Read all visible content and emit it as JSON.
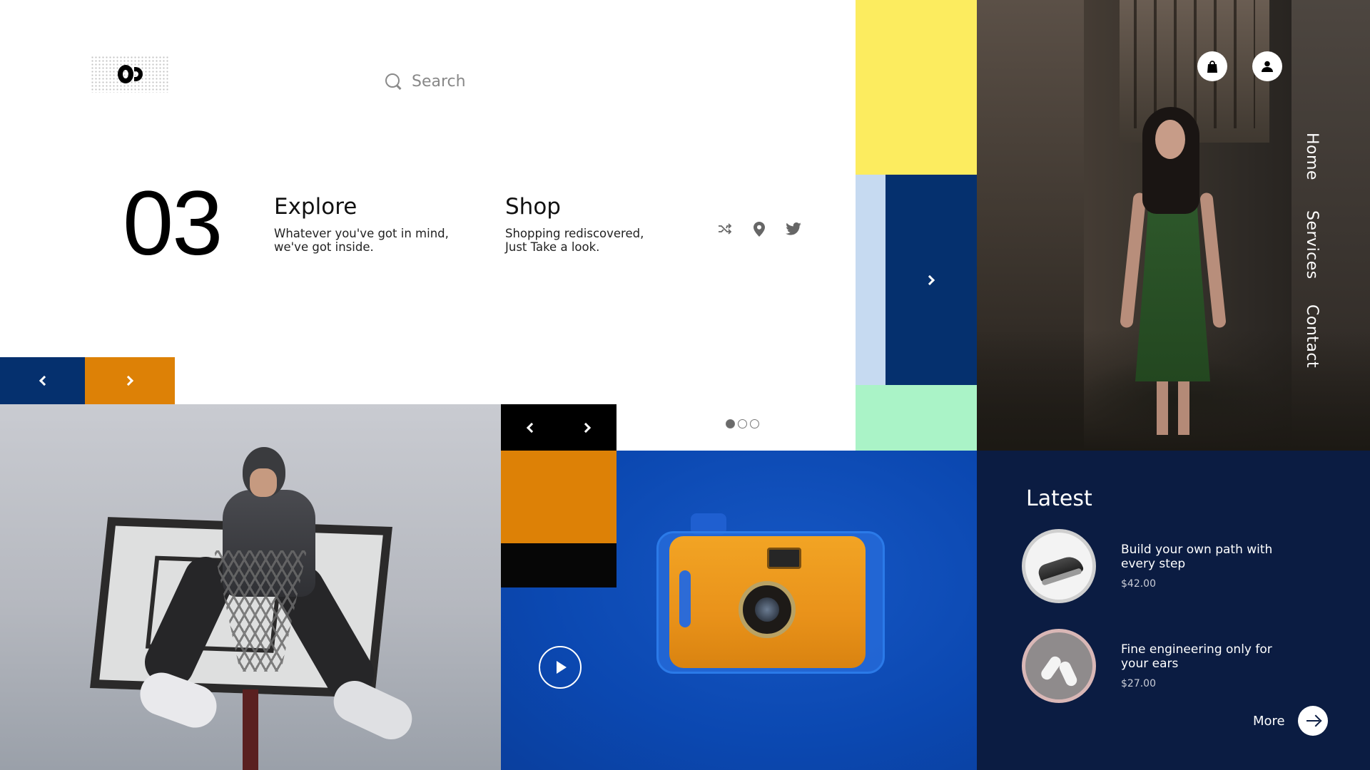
{
  "search": {
    "placeholder": "Search"
  },
  "hero": {
    "slide_number": "03",
    "blocks": [
      {
        "title": "Explore",
        "description": "Whatever you've got in mind,\nwe've got inside."
      },
      {
        "title": "Shop",
        "description": "Shopping rediscovered,\nJust Take a look."
      }
    ],
    "social_icons": [
      "shuffle-icon",
      "location-pin-icon",
      "twitter-icon"
    ],
    "carousel": {
      "total": 3,
      "active": 1
    }
  },
  "nav": {
    "items": [
      "Home",
      "Services",
      "Contact"
    ],
    "icons": [
      "shopping-bag-icon",
      "user-icon"
    ]
  },
  "colors": {
    "navy": "#05306e",
    "orange": "#dd8106",
    "yellow": "#fcec5f",
    "light_blue": "#c6daf1",
    "mint": "#aaf3c7",
    "royal_blue": "#0b48b1",
    "latest_bg": "#0b1c42"
  },
  "latest": {
    "title": "Latest",
    "items": [
      {
        "name": "Build your own path  with every step",
        "price": "$42.00",
        "image": "sneaker"
      },
      {
        "name": "Fine engineering only for your ears",
        "price": "$27.00",
        "image": "earbuds"
      }
    ],
    "more_label": "More"
  }
}
